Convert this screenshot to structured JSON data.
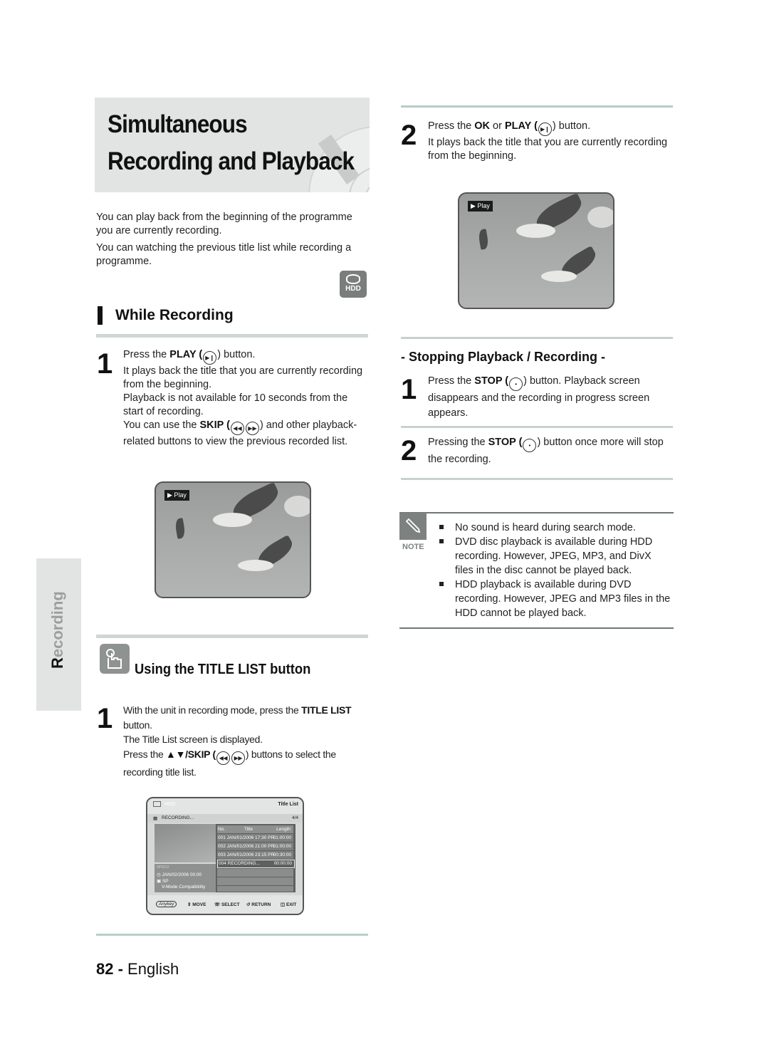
{
  "page": {
    "title_line1": "Simultaneous",
    "title_line2": "Recording and Playback",
    "intro": [
      "You can play back from the beginning of the programme you are currently recording.",
      "You can watching the previous title list while recording a programme."
    ],
    "hdd_badge": "HDD",
    "side_tab": {
      "first": "R",
      "rest": "ecording"
    },
    "footer": {
      "page_number": "82",
      "separator": " - ",
      "language": "English"
    }
  },
  "while_recording": {
    "heading": "While Recording",
    "step1": {
      "number": "1",
      "line1_pre": "Press the ",
      "line1_bold": "PLAY (",
      "line1_post": ") button.",
      "line2": "It plays back the title that you are currently recording from the beginning.",
      "line3": "Playback is not available for 10 seconds from the start of recording.",
      "line4_pre": "You can use the ",
      "line4_bold": "SKIP (",
      "line4_post": ") and other playback-related buttons to view the previous recorded list."
    },
    "screen_label": "▶ Play"
  },
  "title_list_section": {
    "heading": "Using the TITLE LIST button",
    "step1": {
      "number": "1",
      "line1_pre": "With the unit in recording mode, press the ",
      "line1_bold": "TITLE LIST",
      "line1_post": " button.",
      "line2": "The Title List screen is displayed.",
      "line3_pre": "Press the ",
      "line3_bold": "▲▼/SKIP (",
      "line3_post": ") buttons to select the recording title list."
    },
    "screen": {
      "device": "HDD",
      "header_right": "Title List",
      "status": "RECORDING...",
      "count": "4/4",
      "columns": [
        "No.",
        "Title",
        "Length"
      ],
      "rows": [
        {
          "no": "001",
          "title": "JAN/01/2006 17:30 PR",
          "length": "01:00:00"
        },
        {
          "no": "002",
          "title": "JAN/01/2006 21:00 PR",
          "length": "01:00:00"
        },
        {
          "no": "003",
          "title": "JAN/01/2006 23:15 PR",
          "length": "00:30:00"
        },
        {
          "no": "004",
          "title": "RECORDING...",
          "length": "00:00:00"
        }
      ],
      "info_format": "MPEG2",
      "info_date": "JAN/02/2006 00:00",
      "info_mode": "SP",
      "info_compat": "V-Mode Compatibility",
      "footer": {
        "anykey": "Anykey",
        "move": "MOVE",
        "select": "SELECT",
        "return": "RETURN",
        "exit": "EXIT"
      }
    }
  },
  "right_col": {
    "step2": {
      "number": "2",
      "line1_pre": "Press the ",
      "line1_bold_ok": "OK",
      "line1_mid": " or ",
      "line1_bold_play": "PLAY (",
      "line1_post": ") button.",
      "line2": "It plays back the title that you are currently recording from the beginning."
    },
    "screen_label": "▶ Play",
    "stopping": {
      "heading": "- Stopping Playback / Recording -",
      "step1": {
        "number": "1",
        "pre": "Press the ",
        "bold": "STOP (",
        "post": ") button. Playback screen disappears and the recording in progress screen appears."
      },
      "step2": {
        "number": "2",
        "pre": "Pressing the ",
        "bold": "STOP (",
        "post": ") button once more will stop the recording."
      }
    },
    "note": {
      "label": "NOTE",
      "items": [
        "No sound is heard during search mode.",
        "DVD disc playback is available during HDD recording. However, JPEG, MP3, and DivX files in the disc cannot be played back.",
        "HDD playback is available during DVD recording. However, JPEG and MP3 files in the HDD cannot be played back."
      ]
    }
  }
}
